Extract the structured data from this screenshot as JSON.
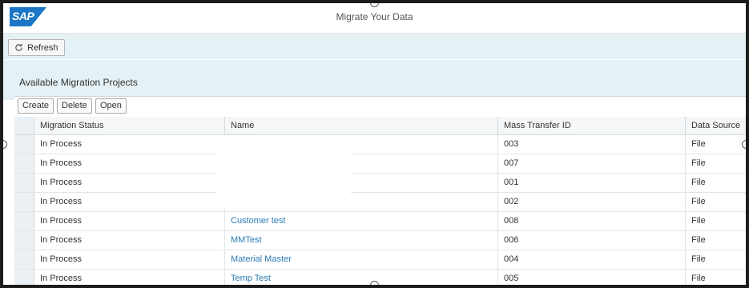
{
  "header": {
    "title": "Migrate Your Data",
    "logo_text": "SAP",
    "logo_color": "#1b77c5"
  },
  "toolbar": {
    "refresh_label": "Refresh",
    "refresh_icon": "refresh-icon"
  },
  "section": {
    "title": "Available Migration Projects"
  },
  "table_toolbar": {
    "create_label": "Create",
    "delete_label": "Delete",
    "open_label": "Open"
  },
  "table": {
    "columns": [
      "Migration Status",
      "Name",
      "Mass Transfer ID",
      "Data Source"
    ],
    "rows": [
      {
        "status": "In Process",
        "name": "",
        "id": "003",
        "source": "File"
      },
      {
        "status": "In Process",
        "name": "",
        "id": "007",
        "source": "File"
      },
      {
        "status": "In Process",
        "name": "",
        "id": "001",
        "source": "File"
      },
      {
        "status": "In Process",
        "name": "",
        "id": "002",
        "source": "File"
      },
      {
        "status": "In Process",
        "name": "Customer test",
        "id": "008",
        "source": "File"
      },
      {
        "status": "In Process",
        "name": "MMTest",
        "id": "006",
        "source": "File"
      },
      {
        "status": "In Process",
        "name": "Material Master",
        "id": "004",
        "source": "File"
      },
      {
        "status": "In Process",
        "name": "Temp Test",
        "id": "005",
        "source": "File"
      }
    ]
  },
  "colors": {
    "link": "#2b7bb5",
    "toolbar_bg": "#e4f1f5",
    "frame": "#1c1c1c"
  }
}
